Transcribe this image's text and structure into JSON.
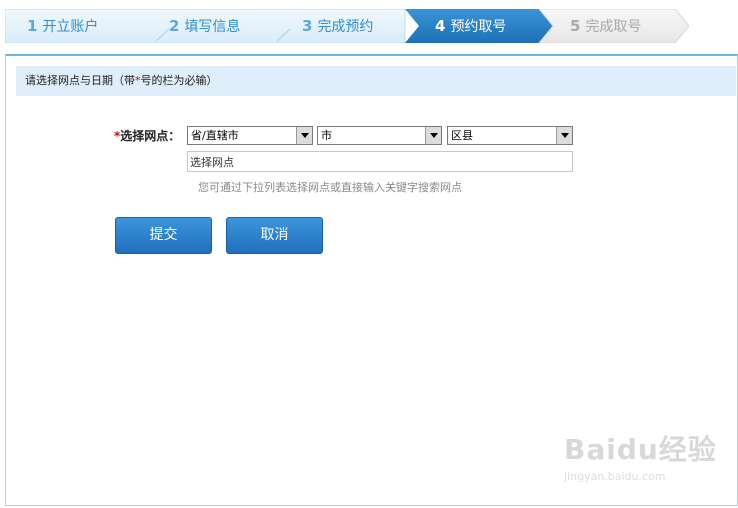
{
  "steps": [
    {
      "num": "1",
      "label": "开立账户"
    },
    {
      "num": "2",
      "label": "填写信息"
    },
    {
      "num": "3",
      "label": "完成预约"
    },
    {
      "num": "4",
      "label": "预约取号"
    },
    {
      "num": "5",
      "label": "完成取号"
    }
  ],
  "notice": {
    "before": "请选择网点与日期（带",
    "star": "*",
    "after": "号的栏为必输）"
  },
  "form": {
    "star": "*",
    "label": "选择网点：",
    "province": "省/直辖市",
    "city": "市",
    "district": "区县",
    "search_value": "选择网点",
    "hint": "您可通过下拉列表选择网点或直接输入关键字搜索网点"
  },
  "buttons": {
    "submit": "提交",
    "cancel": "取消"
  },
  "watermark": {
    "logo": "Baidu经验",
    "url": "jingyan.baidu.com"
  },
  "colors": {
    "accent": "#2b86c9",
    "done_text": "#2f8fcf",
    "todo_text": "#a9a9a9",
    "required": "#e00000"
  }
}
